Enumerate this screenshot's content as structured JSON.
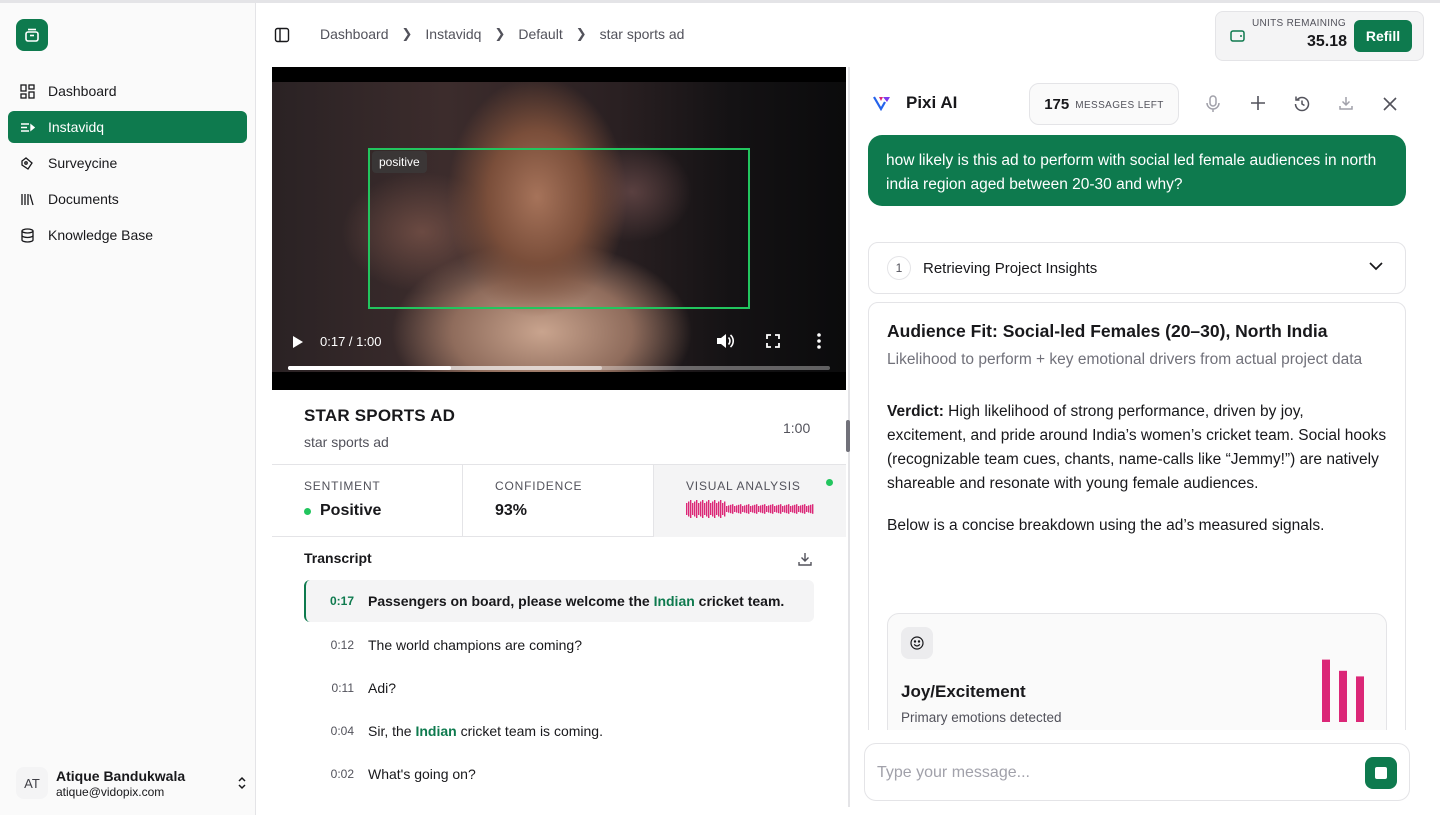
{
  "sidebar": {
    "items": [
      {
        "label": "Dashboard",
        "icon": "dashboard-icon",
        "active": false
      },
      {
        "label": "Instavidq",
        "icon": "list-icon",
        "active": true
      },
      {
        "label": "Surveycine",
        "icon": "survey-icon",
        "active": false
      },
      {
        "label": "Documents",
        "icon": "library-icon",
        "active": false
      },
      {
        "label": "Knowledge Base",
        "icon": "database-icon",
        "active": false
      }
    ],
    "user": {
      "initials": "AT",
      "name": "Atique Bandukwala",
      "email": "atique@vidopix.com"
    }
  },
  "header": {
    "breadcrumb": [
      "Dashboard",
      "Instavidq",
      "Default",
      "star sports ad"
    ],
    "units": {
      "label": "UNITS REMAINING",
      "value": "35.18",
      "refill_label": "Refill"
    }
  },
  "video": {
    "overlay_label": "positive",
    "time": "0:17 / 1:00",
    "progress": 0.3,
    "buffered": 0.58,
    "title": "STAR SPORTS AD",
    "subtitle": "star sports ad",
    "duration": "1:00"
  },
  "stats": {
    "sentiment": {
      "label": "SENTIMENT",
      "value": "Positive"
    },
    "confidence": {
      "label": "CONFIDENCE",
      "value": "93%"
    },
    "visual": {
      "label": "VISUAL ANALYSIS"
    }
  },
  "transcript": {
    "title": "Transcript",
    "rows": [
      {
        "ts": "0:17",
        "pre": "Passengers on board, please welcome the ",
        "hl": "Indian",
        "post": " cricket team."
      },
      {
        "ts": "0:12",
        "pre": "The world champions are coming?",
        "hl": "",
        "post": ""
      },
      {
        "ts": "0:11",
        "pre": "Adi?",
        "hl": "",
        "post": ""
      },
      {
        "ts": "0:04",
        "pre": "Sir, the ",
        "hl": "Indian",
        "post": " cricket team is coming."
      },
      {
        "ts": "0:02",
        "pre": "What's going on?",
        "hl": "",
        "post": ""
      }
    ]
  },
  "chat": {
    "assistant_name": "Pixi AI",
    "messages_left": {
      "count": "175",
      "label": "MESSAGES LEFT"
    },
    "user_message": "how likely is this ad to perform with social led female audiences in north india region aged between 20-30 and why?",
    "step": {
      "number": "1",
      "label": "Retrieving Project Insights"
    },
    "answer": {
      "title": "Audience Fit: Social-led Females (20–30), North India",
      "subtitle": "Likelihood to perform + key emotional drivers from actual project data",
      "verdict_label": "Verdict:",
      "verdict_text": " High likelihood of strong performance, driven by joy, excitement, and pride around India’s women’s cricket team. Social hooks (recognizable team cues, chants, name-calls like “Jemmy!”) are natively shareable and resonate with young female audiences.",
      "breakdown": "Below is a concise breakdown using the ad’s measured signals.",
      "card": {
        "title": "Joy/Excitement",
        "subtitle": "Primary emotions detected",
        "bar_values": [
          0.78,
          0.64,
          0.57
        ]
      }
    },
    "input_placeholder": "Type your message..."
  },
  "colors": {
    "brand": "#0e7a4e",
    "positive": "#22c55e",
    "bars": "#db2777"
  }
}
